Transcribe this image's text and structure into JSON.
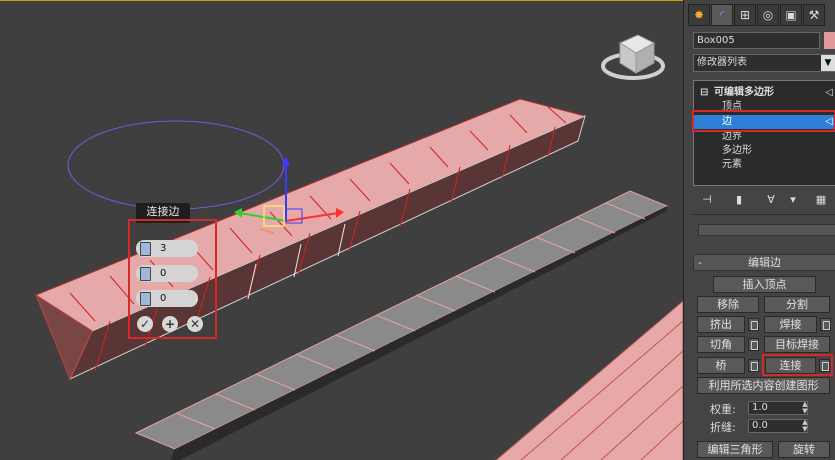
{
  "viewport": {
    "caddy": {
      "title": "连接边",
      "segments_value": "3",
      "pinch_value": "0",
      "slide_value": "0",
      "ok_symbol": "✓",
      "apply_symbol": "+",
      "cancel_symbol": "✕"
    }
  },
  "command_panel": {
    "tabs": [
      "create-icon",
      "modify-icon",
      "hierarchy-icon",
      "motion-icon",
      "display-icon",
      "utilities-icon"
    ],
    "object_name": "Box005",
    "object_color": "#e09a9a",
    "modifier_list": "修改器列表",
    "stack": {
      "root": "可编辑多边形",
      "items": [
        "顶点",
        "边",
        "边界",
        "多边形",
        "元素"
      ],
      "selected_index": 1
    },
    "edit_edges": {
      "title": "编辑边",
      "insert_vertex": "插入顶点",
      "remove": "移除",
      "split": "分割",
      "extrude": "挤出",
      "weld": "焊接",
      "chamfer": "切角",
      "target_weld": "目标焊接",
      "bridge": "桥",
      "connect": "连接",
      "create_shape": "利用所选内容创建图形",
      "weight_label": "权重:",
      "weight_value": "1.0",
      "crease_label": "折缝:",
      "crease_value": "0.0",
      "edit_tri": "编辑三角形",
      "turn": "旋转"
    }
  }
}
